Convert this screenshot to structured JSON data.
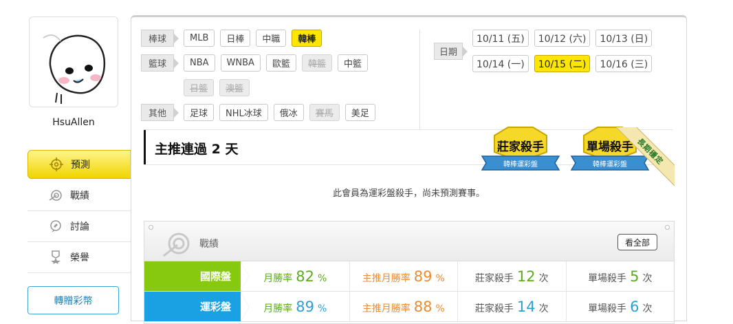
{
  "profile": {
    "username": "HsuAllen"
  },
  "sidebar": {
    "items": [
      {
        "label": "預測",
        "icon": "target-icon",
        "active": true
      },
      {
        "label": "戰績",
        "icon": "record-icon",
        "active": false
      },
      {
        "label": "討論",
        "icon": "discuss-icon",
        "active": false
      },
      {
        "label": "榮譽",
        "icon": "honor-icon",
        "active": false
      }
    ],
    "gift_button": "轉贈彩幣"
  },
  "filters": {
    "baseball": {
      "label": "棒球",
      "options": [
        "MLB",
        "日棒",
        "中職",
        "韓棒"
      ],
      "selected": "韓棒"
    },
    "basketball": {
      "label": "籃球",
      "options": [
        "NBA",
        "WNBA",
        "歐籃",
        "韓籃",
        "中籃",
        "日籃",
        "澳籃"
      ],
      "disabled": [
        "韓籃",
        "日籃",
        "澳籃"
      ]
    },
    "other": {
      "label": "其他",
      "options": [
        "足球",
        "NHL冰球",
        "俄冰",
        "賽馬",
        "美足"
      ],
      "disabled": [
        "賽馬"
      ]
    }
  },
  "dates": {
    "label": "日期",
    "options": [
      "10/11 (五)",
      "10/12 (六)",
      "10/13 (日)",
      "10/14 (一)",
      "10/15 (二)",
      "10/16 (三)"
    ],
    "selected": "10/15 (二)"
  },
  "headline": {
    "title": "主推連過 2 天",
    "badges": [
      {
        "title": "莊家殺手",
        "subtitle": "韓棒運彩盤"
      },
      {
        "title": "單場殺手",
        "subtitle": "韓棒運彩盤"
      }
    ],
    "ribbon": "長期穩定"
  },
  "notice": "此會員為運彩盤殺手，尚未預測賽事。",
  "stats": {
    "title": "戰績",
    "see_all": "看全部",
    "rows": [
      {
        "label": "國際盤",
        "color": "#86c90e",
        "monthly_label": "月勝率",
        "monthly_value": "82",
        "monthly_unit": "%",
        "main_label": "主推月勝率",
        "main_value": "89",
        "main_unit": "%",
        "banker_label": "莊家殺手",
        "banker_value": "12",
        "banker_unit": "次",
        "single_label": "單場殺手",
        "single_value": "5",
        "single_unit": "次"
      },
      {
        "label": "運彩盤",
        "color": "#1aa1e3",
        "monthly_label": "月勝率",
        "monthly_value": "89",
        "monthly_unit": "%",
        "main_label": "主推月勝率",
        "main_value": "88",
        "main_unit": "%",
        "banker_label": "莊家殺手",
        "banker_value": "14",
        "banker_unit": "次",
        "single_label": "單場殺手",
        "single_value": "6",
        "single_unit": "次"
      }
    ]
  }
}
